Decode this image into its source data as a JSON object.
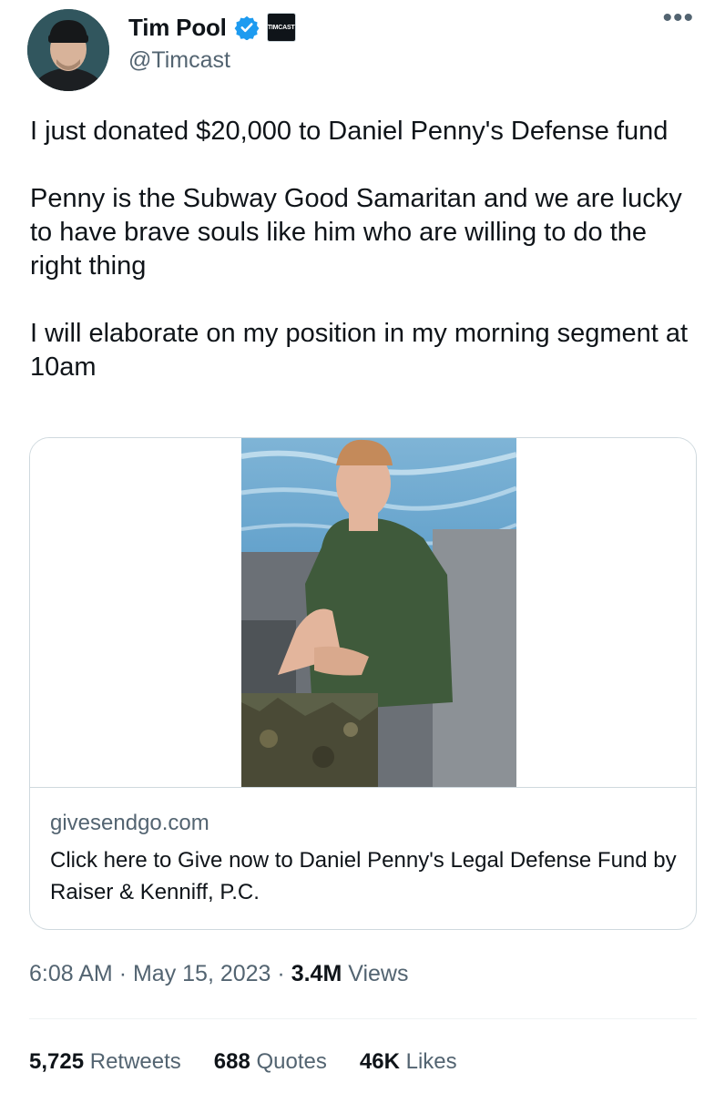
{
  "author": {
    "display_name": "Tim Pool",
    "handle": "@Timcast",
    "affiliate_badge_text": "TIMCAST",
    "verified_color": "#1d9bf0"
  },
  "menu_icon": "more-horizontal-icon",
  "tweet": {
    "text": "I just donated $20,000 to Daniel Penny's Defense fund\n\nPenny is the Subway Good Samaritan and we are lucky to have brave souls like him who are willing to do the right thing\n\nI will elaborate on my position in my morning segment at 10am"
  },
  "card": {
    "domain": "givesendgo.com",
    "title": "Click here to Give now to Daniel Penny's Legal Defense Fund by Raiser & Kenniff, P.C."
  },
  "meta": {
    "time": "6:08 AM",
    "separator": "·",
    "date": "May 15, 2023",
    "views_count": "3.4M",
    "views_label": "Views"
  },
  "stats": {
    "retweets_count": "5,725",
    "retweets_label": "Retweets",
    "quotes_count": "688",
    "quotes_label": "Quotes",
    "likes_count": "46K",
    "likes_label": "Likes"
  }
}
